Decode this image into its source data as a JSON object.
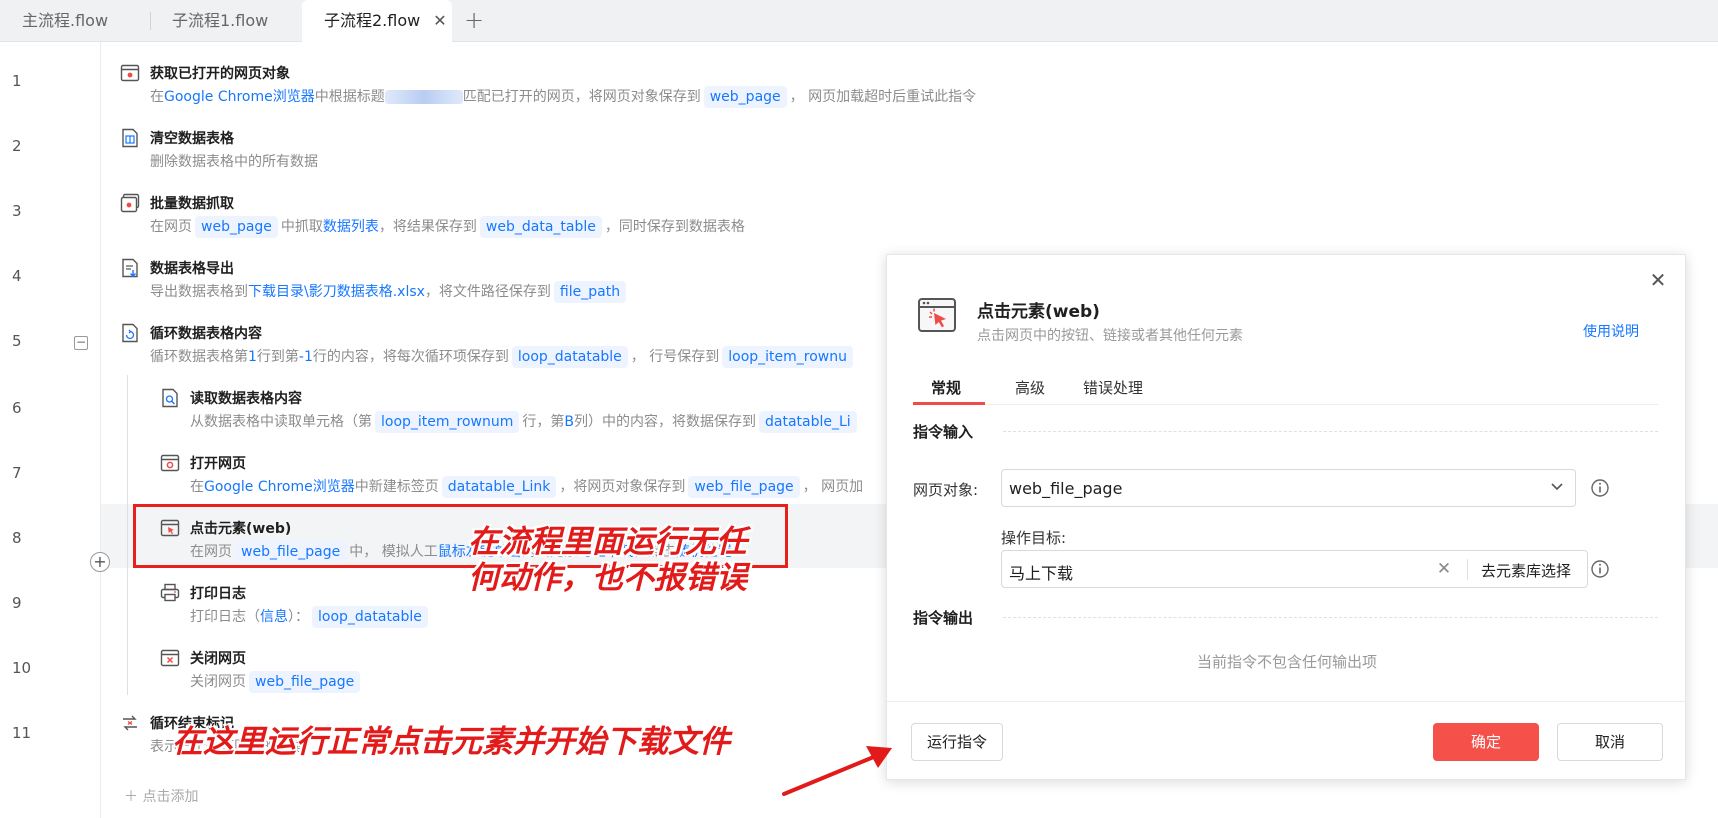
{
  "tabs": [
    {
      "label": "主流程.flow"
    },
    {
      "label": "子流程1.flow"
    },
    {
      "label": "子流程2.flow",
      "active": true
    }
  ],
  "lines": [
    "1",
    "2",
    "3",
    "4",
    "5",
    "6",
    "7",
    "8",
    "9",
    "10",
    "11"
  ],
  "steps": {
    "s1": {
      "title": "获取已打开的网页对象",
      "d1": "在",
      "browser": "Google Chrome浏览器",
      "d2": "中根据标题",
      "d3": "匹配已打开的网页，将网页对象保存到",
      "var": "web_page",
      "d4": "， 网页加载超时后重试此指令"
    },
    "s2": {
      "title": "清空数据表格",
      "desc": "删除数据表格中的所有数据"
    },
    "s3": {
      "title": "批量数据抓取",
      "d1": "在网页",
      "var1": "web_page",
      "d2": "中抓取",
      "link": "数据列表",
      "d3": "，将结果保存到",
      "var2": "web_data_table",
      "d4": "，同时保存到数据表格"
    },
    "s4": {
      "title": "数据表格导出",
      "d1": "导出数据表格到",
      "link": "下载目录\\影刀数据表格.xlsx",
      "d2": "，将文件路径保存到",
      "var": "file_path"
    },
    "s5": {
      "title": "循环数据表格内容",
      "d1": "循环数据表格第",
      "n1": "1",
      "d2": "行到第",
      "n2": "-1",
      "d3": "行的内容，将每次循环项保存到",
      "var1": "loop_datatable",
      "d4": "， 行号保存到",
      "var2": "loop_item_rownu"
    },
    "s6": {
      "title": "读取数据表格内容",
      "d1": "从数据表格中读取单元格（第",
      "var1": "loop_item_rownum",
      "d2": "行，第",
      "col": "B",
      "d3": "列）中的内容，将数据保存到",
      "var2": "datatable_Li"
    },
    "s7": {
      "title": "打开网页",
      "d1": "在",
      "browser": "Google Chrome浏览器",
      "d2": "中新建标签页",
      "var1": "datatable_Link",
      "d3": "，将网页对象保存到",
      "var2": "web_file_page",
      "d4": "， 网页加"
    },
    "s8": {
      "title": "点击元素(web)",
      "d1": "在网页",
      "var": "web_file_page",
      "d2": "中， 模拟人工",
      "link1": "鼠标左键单击",
      "d3": "网页元素",
      "link2": "马上下载",
      "d4": "，点击",
      "link3": "随机位置"
    },
    "s9": {
      "title": "打印日志",
      "d1": "打印日志（",
      "link": "信息",
      "d2": "）：",
      "var": "loop_datatable"
    },
    "s10": {
      "title": "关闭网页",
      "d1": "关闭网页",
      "var": "web_file_page"
    },
    "s11": {
      "title": "循环结束标记",
      "desc": "表示一个循环区域的结尾"
    }
  },
  "collapse_symbol": "−",
  "add_symbol": "+",
  "bottom_add": "点击添加",
  "annotations": {
    "a1_line1": "在流程里面运行无任",
    "a1_line2": "何动作，也不报错误",
    "a2": "在这里运行正常点击元素并开始下载文件"
  },
  "panel": {
    "title": "点击元素(web)",
    "subtitle": "点击网页中的按钮、链接或者其他任何元素",
    "help": "使用说明",
    "tabs": [
      "常规",
      "高级",
      "错误处理"
    ],
    "input_section": "指令输入",
    "page_label": "网页对象:",
    "page_value": "web_file_page",
    "target_label": "操作目标:",
    "target_value": "马上下载",
    "target_pick": "去元素库选择",
    "output_section": "指令输出",
    "no_output": "当前指令不包含任何输出项",
    "run": "运行指令",
    "ok": "确定",
    "cancel": "取消",
    "close_symbol": "✕",
    "clear_symbol": "✕"
  },
  "colors": {
    "accent": "#1677ff",
    "primary_button": "#f5504a",
    "annotation": "#e21a1a"
  }
}
